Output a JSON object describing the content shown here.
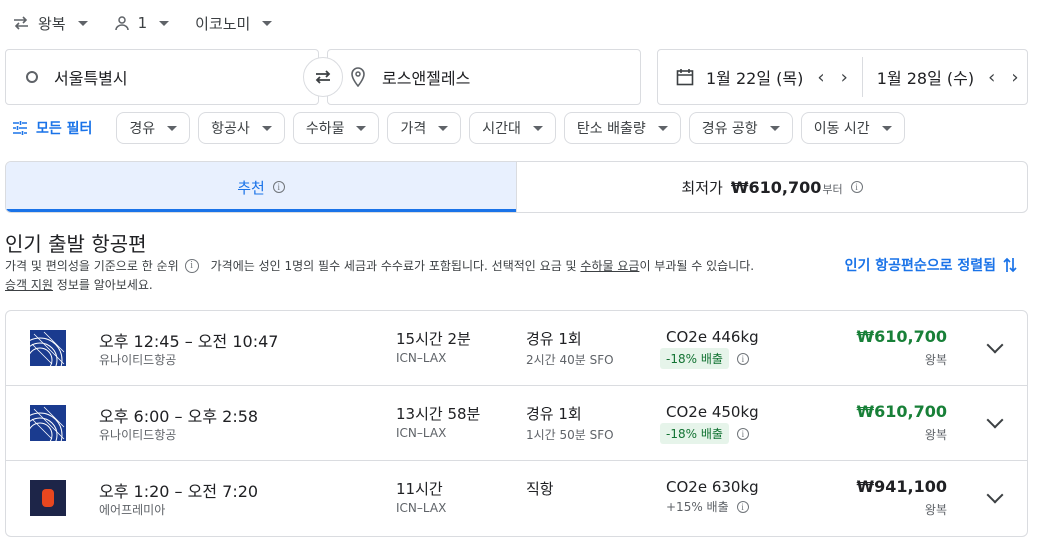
{
  "top": {
    "trip_type": "왕복",
    "passengers": "1",
    "cabin": "이코노미"
  },
  "search": {
    "origin": "서울특별시",
    "destination": "로스앤젤레스",
    "depart_date": "1월 22일 (목)",
    "return_date": "1월 28일 (수)"
  },
  "filters": {
    "all": "모든 필터",
    "chips": [
      "경유",
      "항공사",
      "수하물",
      "가격",
      "시간대",
      "탄소 배출량",
      "경유 공항",
      "이동 시간"
    ]
  },
  "tabs": {
    "recommended": "추천",
    "cheapest_label": "최저가",
    "cheapest_price": "₩610,700",
    "cheapest_suffix": "부터"
  },
  "section": {
    "title": "인기 출발 항공편",
    "note_prefix": "가격 및 편의성을 기준으로 한 순위",
    "note_main": "가격에는 성인 1명의 필수 세금과 수수료가 포함됩니다. 선택적인 요금 및",
    "note_link": "수하물 요금",
    "note_suffix": "이 부과될 수 있습니다.",
    "note2_link": "승객 지원",
    "note2_rest": " 정보를 알아보세요.",
    "sort_link": "인기 항공편순으로 정렬됨"
  },
  "flights": [
    {
      "times": "오후 12:45 – 오전 10:47",
      "airline": "유나이티드항공",
      "duration": "15시간 2분",
      "route": "ICN–LAX",
      "stops": "경유 1회",
      "stop_detail": "2시간 40분 SFO",
      "co2": "CO2e 446kg",
      "emission": "-18% 배출",
      "price": "₩610,700",
      "trip": "왕복"
    },
    {
      "times": "오후 6:00 – 오후 2:58",
      "airline": "유나이티드항공",
      "duration": "13시간 58분",
      "route": "ICN–LAX",
      "stops": "경유 1회",
      "stop_detail": "1시간 50분 SFO",
      "co2": "CO2e 450kg",
      "emission": "-18% 배출",
      "price": "₩610,700",
      "trip": "왕복"
    },
    {
      "times": "오후 1:20 – 오전 7:20",
      "airline": "에어프레미아",
      "duration": "11시간",
      "route": "ICN–LAX",
      "stops": "직항",
      "stop_detail": "",
      "co2": "CO2e 630kg",
      "emission": "+15% 배출",
      "price": "₩941,100",
      "trip": "왕복"
    }
  ],
  "colors": {
    "accent": "#1a73e8",
    "price_green": "#188038",
    "emission_bg": "#e6f4ea",
    "united": "#1a3b8f",
    "premia_bg": "#1d2548",
    "premia_mark": "#e8471f"
  }
}
